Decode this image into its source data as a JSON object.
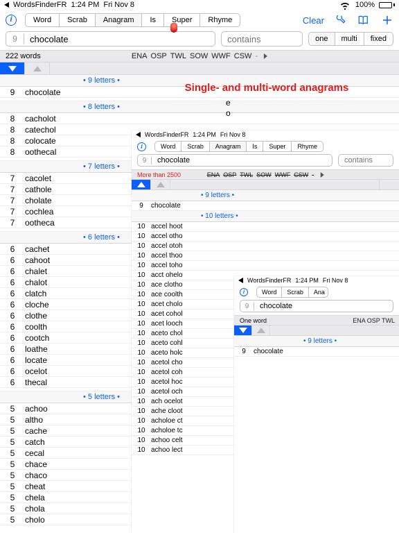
{
  "status": {
    "back_app": "WordsFinderFR",
    "time": "1:24 PM",
    "date": "Fri Nov 8",
    "battery_pct": "100%"
  },
  "toolbar": {
    "seg": [
      "Word",
      "Scrab",
      "Anagram",
      "Is",
      "Super",
      "Rhyme"
    ],
    "clear": "Clear"
  },
  "inputs": {
    "count": "9",
    "query": "chocolate",
    "contains_placeholder": "contains",
    "mode_seg": [
      "one",
      "multi",
      "fixed"
    ]
  },
  "dictbar": {
    "wordcount": "222 words",
    "dicts": [
      "ENA",
      "OSP",
      "TWL",
      "SOW",
      "WWF",
      "CSW"
    ]
  },
  "headline": "Single- and multi-word anagrams",
  "subline": [
    "e",
    "o"
  ],
  "groups": {
    "g9": "• 9 letters •",
    "g10": "• 10 letters •",
    "g8": "• 8 letters •",
    "g7": "• 7 letters •",
    "g6": "• 6 letters •",
    "g5": "• 5 letters •"
  },
  "main_list": [
    {
      "hdr": "g9"
    },
    {
      "n": "9",
      "w": "chocolate"
    },
    {
      "hdr": "g8"
    },
    {
      "n": "8",
      "w": "cacholot"
    },
    {
      "n": "8",
      "w": "catechol"
    },
    {
      "n": "8",
      "w": "colocate"
    },
    {
      "n": "8",
      "w": "oothecal"
    },
    {
      "hdr": "g7"
    },
    {
      "n": "7",
      "w": "cacolet"
    },
    {
      "n": "7",
      "w": "cathole"
    },
    {
      "n": "7",
      "w": "cholate"
    },
    {
      "n": "7",
      "w": "cochlea"
    },
    {
      "n": "7",
      "w": "ootheca"
    },
    {
      "hdr": "g6"
    },
    {
      "n": "6",
      "w": "cachet"
    },
    {
      "n": "6",
      "w": "cahoot"
    },
    {
      "n": "6",
      "w": "chalet"
    },
    {
      "n": "6",
      "w": "chalot"
    },
    {
      "n": "6",
      "w": "clatch"
    },
    {
      "n": "6",
      "w": "cloche"
    },
    {
      "n": "6",
      "w": "clothe"
    },
    {
      "n": "6",
      "w": "coolth"
    },
    {
      "n": "6",
      "w": "cootch"
    },
    {
      "n": "6",
      "w": "loathe"
    },
    {
      "n": "6",
      "w": "locate"
    },
    {
      "n": "6",
      "w": "ocelot"
    },
    {
      "n": "6",
      "w": "thecal"
    },
    {
      "hdr": "g5"
    },
    {
      "n": "5",
      "w": "achoo"
    },
    {
      "n": "5",
      "w": "altho"
    },
    {
      "n": "5",
      "w": "cache"
    },
    {
      "n": "5",
      "w": "catch"
    },
    {
      "n": "5",
      "w": "cecal"
    },
    {
      "n": "5",
      "w": "chace"
    },
    {
      "n": "5",
      "w": "chaco"
    },
    {
      "n": "5",
      "w": "cheat"
    },
    {
      "n": "5",
      "w": "chela"
    },
    {
      "n": "5",
      "w": "chola"
    },
    {
      "n": "5",
      "w": "cholo"
    }
  ],
  "panel1": {
    "wordcount": "More than 2500",
    "list": [
      {
        "hdr": "g9"
      },
      {
        "n": "9",
        "w": "chocolate"
      },
      {
        "hdr": "g10"
      },
      {
        "n": "10",
        "w": "accel hoot"
      },
      {
        "n": "10",
        "w": "accel otho"
      },
      {
        "n": "10",
        "w": "accel otoh"
      },
      {
        "n": "10",
        "w": "accel thoo"
      },
      {
        "n": "10",
        "w": "accel toho"
      },
      {
        "n": "10",
        "w": "acct ohelo"
      },
      {
        "n": "10",
        "w": "ace clotho"
      },
      {
        "n": "10",
        "w": "ace coolth"
      },
      {
        "n": "10",
        "w": "acet cholo"
      },
      {
        "n": "10",
        "w": "acet cohol"
      },
      {
        "n": "10",
        "w": "acet looch"
      },
      {
        "n": "10",
        "w": "aceto chol"
      },
      {
        "n": "10",
        "w": "aceto cohl"
      },
      {
        "n": "10",
        "w": "aceto holc"
      },
      {
        "n": "10",
        "w": "acetol cho"
      },
      {
        "n": "10",
        "w": "acetol coh"
      },
      {
        "n": "10",
        "w": "acetol hoc"
      },
      {
        "n": "10",
        "w": "acetol och"
      },
      {
        "n": "10",
        "w": "ach ocelot"
      },
      {
        "n": "10",
        "w": "ache cloot"
      },
      {
        "n": "10",
        "w": "acholoe ct"
      },
      {
        "n": "10",
        "w": "acholoe tc"
      },
      {
        "n": "10",
        "w": "achoo celt"
      },
      {
        "n": "10",
        "w": "achoo lect"
      }
    ]
  },
  "panel2": {
    "wordcount": "One word",
    "dicts_text": "ENA OSP TWL",
    "list": [
      {
        "hdr": "g9"
      },
      {
        "n": "9",
        "w": "chocolate"
      }
    ]
  }
}
